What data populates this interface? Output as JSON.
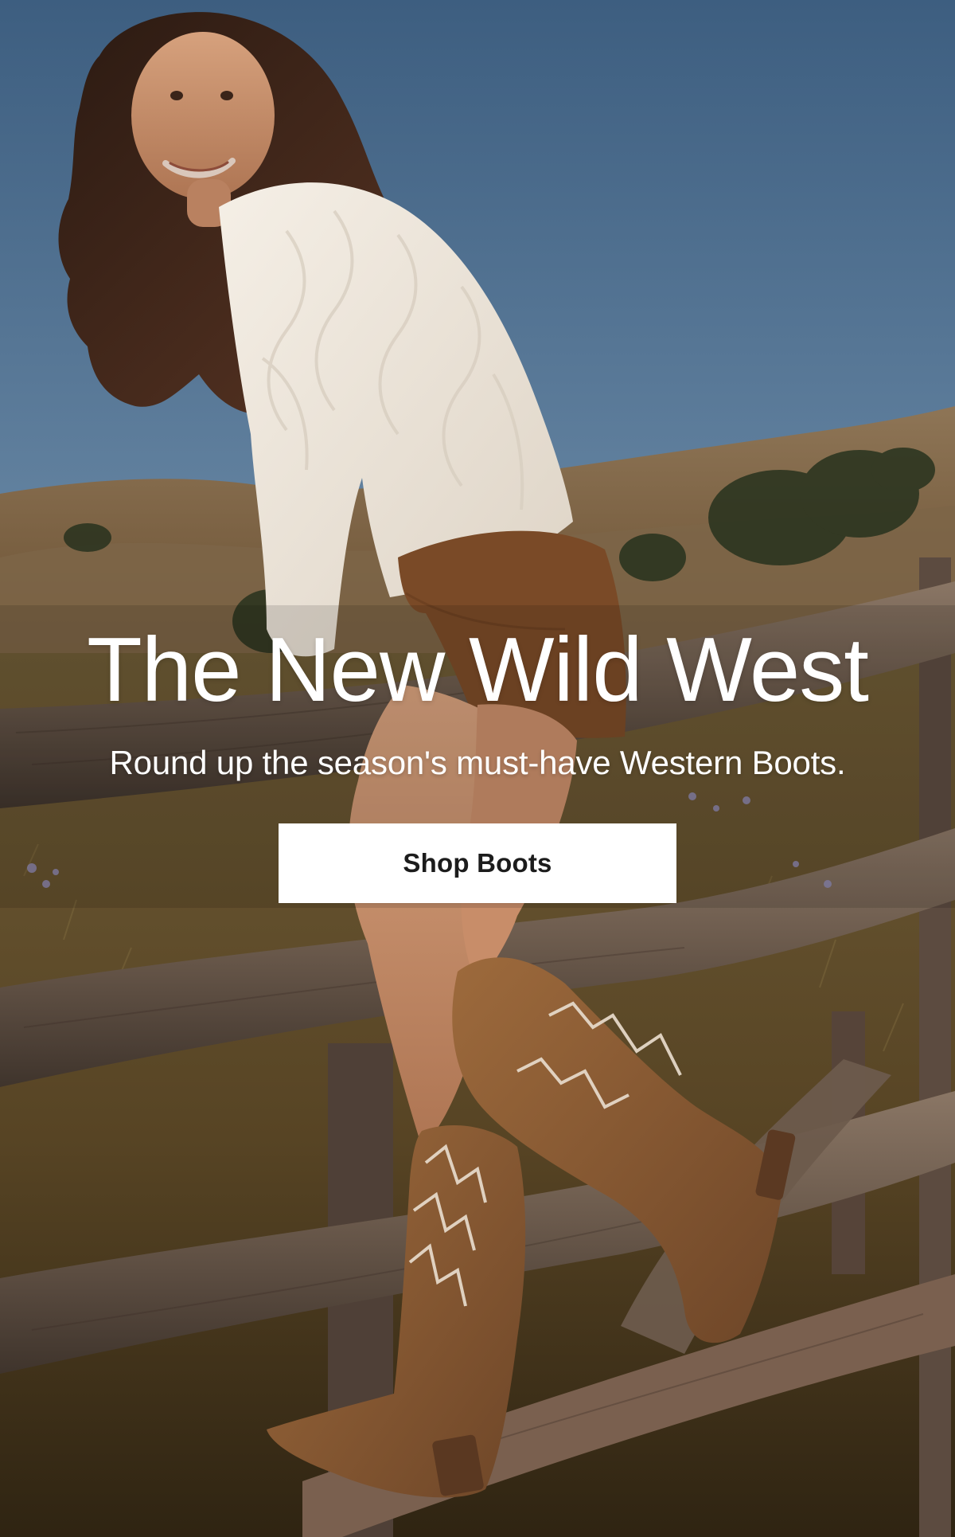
{
  "hero": {
    "headline": "The New Wild West",
    "subhead": "Round up the season's must-have Western Boots.",
    "cta_label": "Shop Boots",
    "colors": {
      "text": "#ffffff",
      "button_bg": "#ffffff",
      "button_text": "#1c1c1c"
    }
  }
}
